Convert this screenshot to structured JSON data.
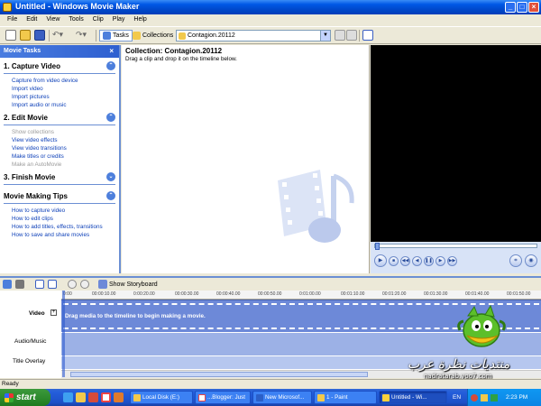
{
  "window": {
    "title": "Untitled - Windows Movie Maker"
  },
  "menu": [
    "File",
    "Edit",
    "View",
    "Tools",
    "Clip",
    "Play",
    "Help"
  ],
  "toolbar": {
    "tasks_label": "Tasks",
    "collections_label": "Collections",
    "collection_select_value": "Contagion.20112"
  },
  "task_pane": {
    "header": "Movie Tasks",
    "close_glyph": "×",
    "sections": [
      {
        "title": "1. Capture Video",
        "items": [
          {
            "label": "Capture from video device",
            "enabled": true
          },
          {
            "label": "Import video",
            "enabled": true
          },
          {
            "label": "Import pictures",
            "enabled": true
          },
          {
            "label": "Import audio or music",
            "enabled": true
          }
        ]
      },
      {
        "title": "2. Edit Movie",
        "items": [
          {
            "label": "Show collections",
            "enabled": false
          },
          {
            "label": "View video effects",
            "enabled": true
          },
          {
            "label": "View video transitions",
            "enabled": true
          },
          {
            "label": "Make titles or credits",
            "enabled": true
          },
          {
            "label": "Make an AutoMovie",
            "enabled": false
          }
        ]
      },
      {
        "title": "3. Finish Movie",
        "items": []
      },
      {
        "title": "Movie Making Tips",
        "items": [
          {
            "label": "How to capture video",
            "enabled": true
          },
          {
            "label": "How to edit clips",
            "enabled": true
          },
          {
            "label": "How to add titles, effects, transitions",
            "enabled": true
          },
          {
            "label": "How to save and share movies",
            "enabled": true
          }
        ]
      }
    ]
  },
  "collection": {
    "title": "Collection: Contagion.20112",
    "hint": "Drag a clip and drop it on the timeline below."
  },
  "timeline": {
    "storyboard_label": "Show Storyboard",
    "ruler_ticks": [
      "0:00",
      "00:00:10.00",
      "0:00:20.00",
      "00:00:30.00",
      "00:00:40.00",
      "00:00:50.00",
      "0:01:00.00",
      "00:01:10.00",
      "00:01:20.00",
      "00:01:30.00",
      "00:01:40.00",
      "00:01:50.00"
    ],
    "tracks": {
      "video": "Video",
      "audio": "Audio/Music",
      "overlay": "Title Overlay"
    },
    "video_message": "Drag media to the timeline to begin making a movie."
  },
  "watermark": {
    "arabic": "منتديات نظرة عرب",
    "domain": "nadratarab.yoo7.com"
  },
  "status": {
    "text": "Ready"
  },
  "taskbar": {
    "start_label": "start",
    "buttons": [
      {
        "label": "Local Disk (E:)",
        "active": false
      },
      {
        "label": "...Blogger: Just",
        "active": false
      },
      {
        "label": "New Microsof...",
        "active": false
      },
      {
        "label": "1 - Paint",
        "active": false
      },
      {
        "label": "Untitled - Wi...",
        "active": true
      }
    ],
    "language": "EN",
    "clock": "2:23 PM"
  },
  "colors": {
    "accent": "#0058e6",
    "link": "#0c3fb8",
    "timeline_video": "#6d89d8"
  }
}
